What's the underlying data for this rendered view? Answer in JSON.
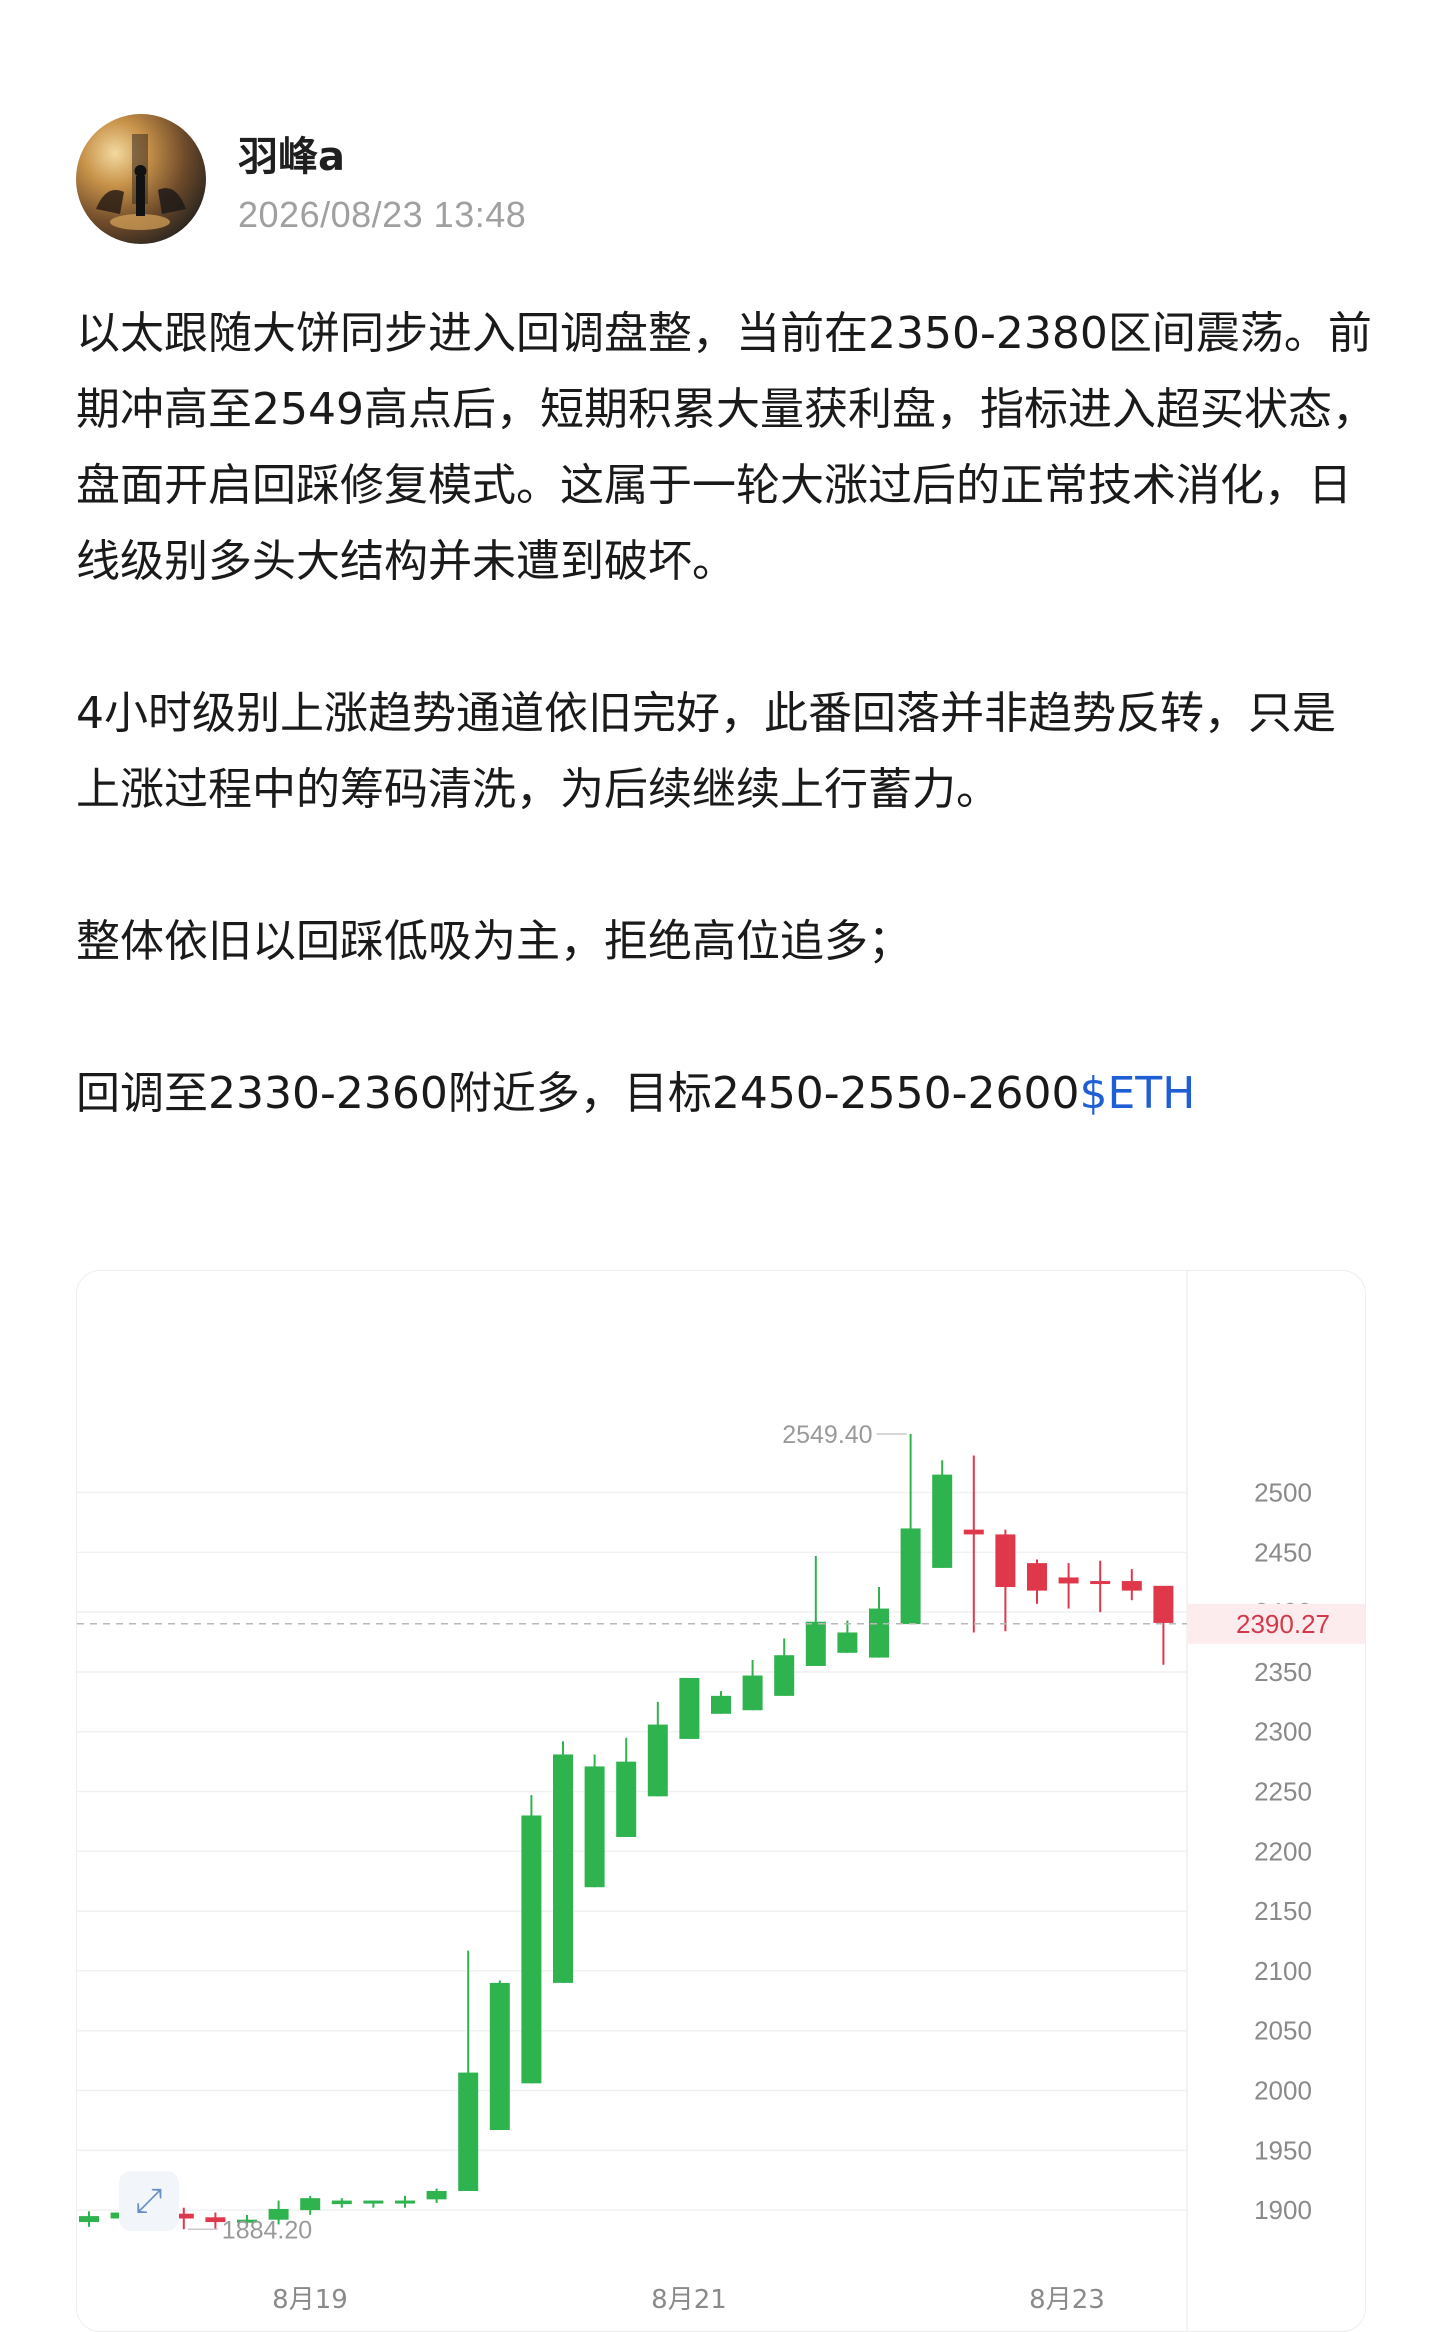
{
  "post": {
    "author": "羽峰a",
    "timestamp": "2026/08/23 13:48",
    "paragraphs": [
      "以太跟随大饼同步进入回调盘整，当前在2350-2380区间震荡。前期冲高至2549高点后，短期积累大量获利盘，指标进入超买状态，盘面开启回踩修复模式。这属于一轮大涨过后的正常技术消化，日线级别多头大结构并未遭到破坏。",
      "4小时级别上涨趋势通道依旧完好，此番回落并非趋势反转，只是上涨过程中的筹码清洗，为后续继续上行蓄力。",
      "整体依旧以回踩低吸为主，拒绝高位追多；"
    ],
    "last_paragraph": "回调至2330-2360附近多，目标2450-2550-2600",
    "ticker": "$ETH"
  },
  "chart": {
    "expand_icon": "expand-arrows-icon"
  },
  "chart_data": {
    "type": "candlestick",
    "current_price": "2390.27",
    "high_label": "2549.40",
    "low_label": "1884.20",
    "ylim": [
      1870,
      2610
    ],
    "y_ticks": [
      "1900",
      "1950",
      "2000",
      "2050",
      "2100",
      "2150",
      "2200",
      "2250",
      "2300",
      "2350",
      "2400",
      "2450",
      "2500"
    ],
    "x_ticks": [
      "8月19",
      "8月21",
      "8月23"
    ],
    "up_color": "#2fb34f",
    "down_color": "#e0384b",
    "candles": [
      {
        "o": 1890,
        "h": 1899,
        "l": 1886,
        "c": 1895
      },
      {
        "o": 1893,
        "h": 1900,
        "l": 1890,
        "c": 1898
      },
      {
        "o": 1894,
        "h": 1904,
        "l": 1890,
        "c": 1898
      },
      {
        "o": 1897,
        "h": 1902,
        "l": 1884,
        "c": 1893
      },
      {
        "o": 1894,
        "h": 1898,
        "l": 1884,
        "c": 1890
      },
      {
        "o": 1892,
        "h": 1896,
        "l": 1886,
        "c": 1892
      },
      {
        "o": 1892,
        "h": 1908,
        "l": 1888,
        "c": 1901
      },
      {
        "o": 1900,
        "h": 1912,
        "l": 1896,
        "c": 1910
      },
      {
        "o": 1905,
        "h": 1910,
        "l": 1902,
        "c": 1908
      },
      {
        "o": 1908,
        "h": 1908,
        "l": 1902,
        "c": 1908
      },
      {
        "o": 1908,
        "h": 1912,
        "l": 1902,
        "c": 1908
      },
      {
        "o": 1909,
        "h": 1918,
        "l": 1906,
        "c": 1916
      },
      {
        "o": 1916,
        "h": 2117,
        "l": 1916,
        "c": 2015
      },
      {
        "o": 1967,
        "h": 2092,
        "l": 1967,
        "c": 2090
      },
      {
        "o": 2006,
        "h": 2247,
        "l": 2006,
        "c": 2230
      },
      {
        "o": 2090,
        "h": 2292,
        "l": 2090,
        "c": 2281
      },
      {
        "o": 2170,
        "h": 2281,
        "l": 2170,
        "c": 2271
      },
      {
        "o": 2212,
        "h": 2295,
        "l": 2212,
        "c": 2275
      },
      {
        "o": 2246,
        "h": 2325,
        "l": 2246,
        "c": 2306
      },
      {
        "o": 2294,
        "h": 2343,
        "l": 2294,
        "c": 2345
      },
      {
        "o": 2315,
        "h": 2334,
        "l": 2315,
        "c": 2330
      },
      {
        "o": 2318,
        "h": 2360,
        "l": 2318,
        "c": 2347
      },
      {
        "o": 2330,
        "h": 2378,
        "l": 2330,
        "c": 2364
      },
      {
        "o": 2355,
        "h": 2447,
        "l": 2355,
        "c": 2392
      },
      {
        "o": 2366,
        "h": 2393,
        "l": 2366,
        "c": 2383
      },
      {
        "o": 2362,
        "h": 2421,
        "l": 2362,
        "c": 2403
      },
      {
        "o": 2390,
        "h": 2549,
        "l": 2390,
        "c": 2470
      },
      {
        "o": 2437,
        "h": 2527,
        "l": 2437,
        "c": 2515
      },
      {
        "o": 2469,
        "h": 2531,
        "l": 2383,
        "c": 2465
      },
      {
        "o": 2465,
        "h": 2469,
        "l": 2384,
        "c": 2421
      },
      {
        "o": 2441,
        "h": 2444,
        "l": 2407,
        "c": 2418
      },
      {
        "o": 2429,
        "h": 2441,
        "l": 2403,
        "c": 2424
      },
      {
        "o": 2426,
        "h": 2443,
        "l": 2400,
        "c": 2424
      },
      {
        "o": 2426,
        "h": 2436,
        "l": 2410,
        "c": 2418
      },
      {
        "o": 2422,
        "h": 2422,
        "l": 2356,
        "c": 2391
      }
    ]
  }
}
